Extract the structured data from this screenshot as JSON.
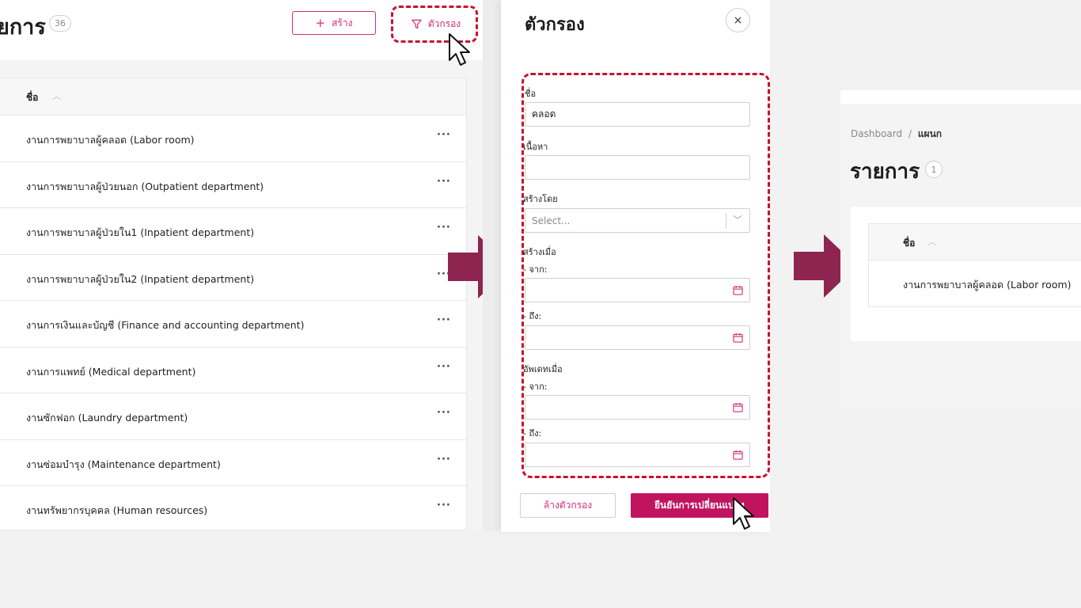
{
  "colors": {
    "accent": "#d62b73",
    "primary_button": "#c0145f",
    "highlight_dash": "#c8102e",
    "arrow": "#8e2450"
  },
  "left": {
    "title": "ยการ",
    "count": "36",
    "create_label": "สร้าง",
    "filter_label": "ตัวกรอง",
    "column_name": "ชื่อ",
    "rows": [
      "งานการพยาบาลผู้คลอด (Labor room)",
      "งานการพยาบาลผู้ป่วยนอก (Outpatient department)",
      "งานการพยาบาลผู้ป่วยใน1 (Inpatient department)",
      "งานการพยาบาลผู้ป่วยใน2 (Inpatient department)",
      "งานการเงินและบัญชี (Finance and accounting department)",
      "งานการแพทย์ (Medical department)",
      "งานซักฟอก (Laundry department)",
      "งานซ่อมบำรุง (Maintenance department)",
      "งานทรัพยากรบุคคล (Human resources)"
    ],
    "row_more": "···"
  },
  "drawer": {
    "title": "ตัวกรอง",
    "close_icon": "×",
    "name_label": "ชื่อ",
    "name_value": "คลอด",
    "content_label": "เนื้อหา",
    "content_value": "",
    "created_by_label": "สร้างโดย",
    "created_by_placeholder": "Select...",
    "created_at_label": "สร้างเมื่อ",
    "updated_at_label": "อัพเดทเมื่อ",
    "from_label": "- จาก:",
    "to_label": "- ถึง:",
    "clear_label": "ล้างตัวกรอง",
    "confirm_label": "ยืนยันการเปลี่ยนแปลง"
  },
  "right": {
    "breadcrumb_root": "Dashboard",
    "breadcrumb_sep": "/",
    "breadcrumb_current": "แผนก",
    "title": "รายการ",
    "count": "1",
    "column_name": "ชื่อ",
    "rows": [
      "งานการพยาบาลผู้คลอด (Labor room)"
    ]
  }
}
